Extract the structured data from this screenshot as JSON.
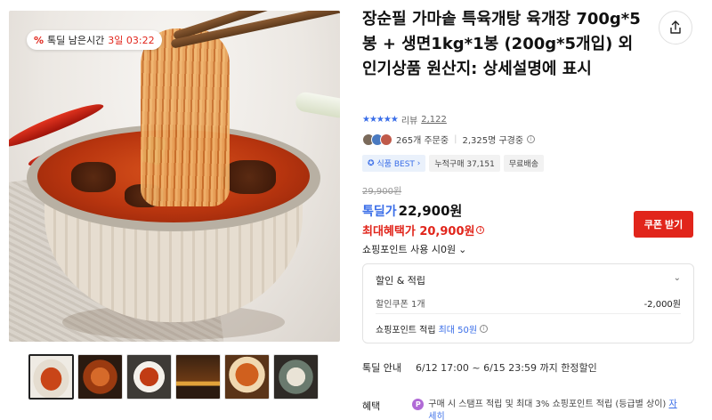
{
  "deal_badge": {
    "icon": "%",
    "label": "톡딜 남은시간",
    "time": "3일 03:22"
  },
  "product": {
    "title": "장순필 가마솥 특육개탕 육개장 700g*5봉 + 생면1kg*1봉 (200g*5개입) 외 인기상품 원산지: 상세설명에 표시",
    "rating_stars": 5,
    "review_label": "리뷰",
    "review_count": "2,122",
    "orders": "265개 주문중",
    "subscribers": "2,325명 구경중",
    "tags": [
      "식품 BEST",
      "누적구매 37,151",
      "무료배송"
    ],
    "original_price": "29,900원",
    "deal_label": "톡딜가",
    "deal_price": "22,900원",
    "max_benefit_price": "최대혜택가 20,900원",
    "coupon_button": "쿠폰 받기",
    "points_use": "쇼핑포인트 사용 시0원"
  },
  "discount_box": {
    "header": "할인 & 적립",
    "coupon_label": "할인쿠폰 1개",
    "coupon_value": "-2,000원",
    "points_label": "쇼핑포인트 적립",
    "points_value": "최대 50원"
  },
  "deal_info": {
    "label": "톡딜 안내",
    "value": "6/12 17:00 ~ 6/15 23:59 까지 한정할인"
  },
  "benefit": {
    "label": "혜택",
    "badge": "P",
    "text": "구매 시 스탬프 적립 및 최대 3% 쇼핑포인트 적립 (등급별 상이)",
    "link": "자세히"
  },
  "thumbnails": 6,
  "colors": {
    "accent_red": "#e1251b",
    "accent_blue": "#3a6ee8"
  }
}
